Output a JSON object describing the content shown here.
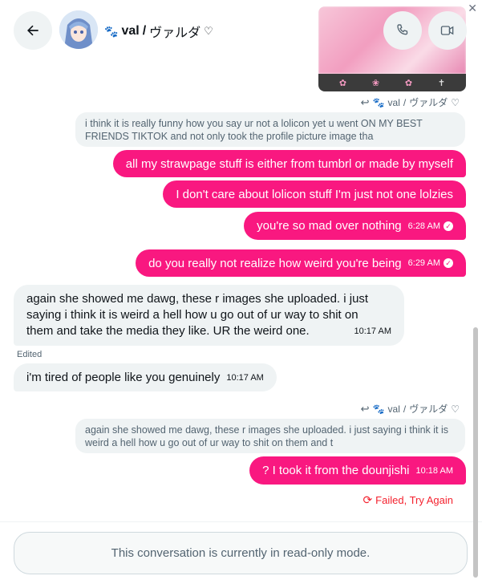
{
  "header": {
    "contact_name": "val",
    "separator": "/",
    "contact_jp": "ヴァルダ",
    "heart": "♡",
    "back_icon": "arrow-left-icon",
    "call_icon": "phone-icon",
    "video_icon": "video-icon"
  },
  "reply_contexts": [
    {
      "name": "val",
      "separator": "/",
      "jp": "ヴァルダ",
      "heart": "♡"
    },
    {
      "name": "val",
      "separator": "/",
      "jp": "ヴァルダ",
      "heart": "♡"
    }
  ],
  "messages": {
    "quote1": "i think it is really funny how you say ur not a lolicon yet u went ON MY BEST FRIENDS TIKTOK and not only took the profile picture image tha",
    "out1": "all my strawpage stuff is either from tumbrl or made by myself",
    "out2": "I don't care about lolicon stuff I'm just not one lolzies",
    "out3": "you're so mad over nothing",
    "out3_time": "6:28 AM",
    "out4": "do you really not realize how weird you're being",
    "out4_time": "6:29 AM",
    "in1_line1": "again she showed me dawg, these r images she uploaded. i just",
    "in1_line2": "saying i think it is weird a hell how u go out of ur way to shit on",
    "in1_line3": "them and take the media they like. UR the weird one.",
    "in1_time": "10:17 AM",
    "edited_label": "Edited",
    "in2": "i'm tired of people like you genuinely",
    "in2_time": "10:17 AM",
    "quote2": "again she showed me dawg, these r images she uploaded. i just saying i think it is weird a hell how u go out of ur way to shit on them and t",
    "out5": "? I took it from the dounjishi",
    "out5_time": "10:18 AM",
    "failed": "Failed, Try Again"
  },
  "footer": {
    "readonly_text": "This conversation is currently in read-only mode."
  },
  "colors": {
    "accent": "#f91880",
    "incoming_bg": "#eff3f4",
    "error": "#f4212e"
  }
}
